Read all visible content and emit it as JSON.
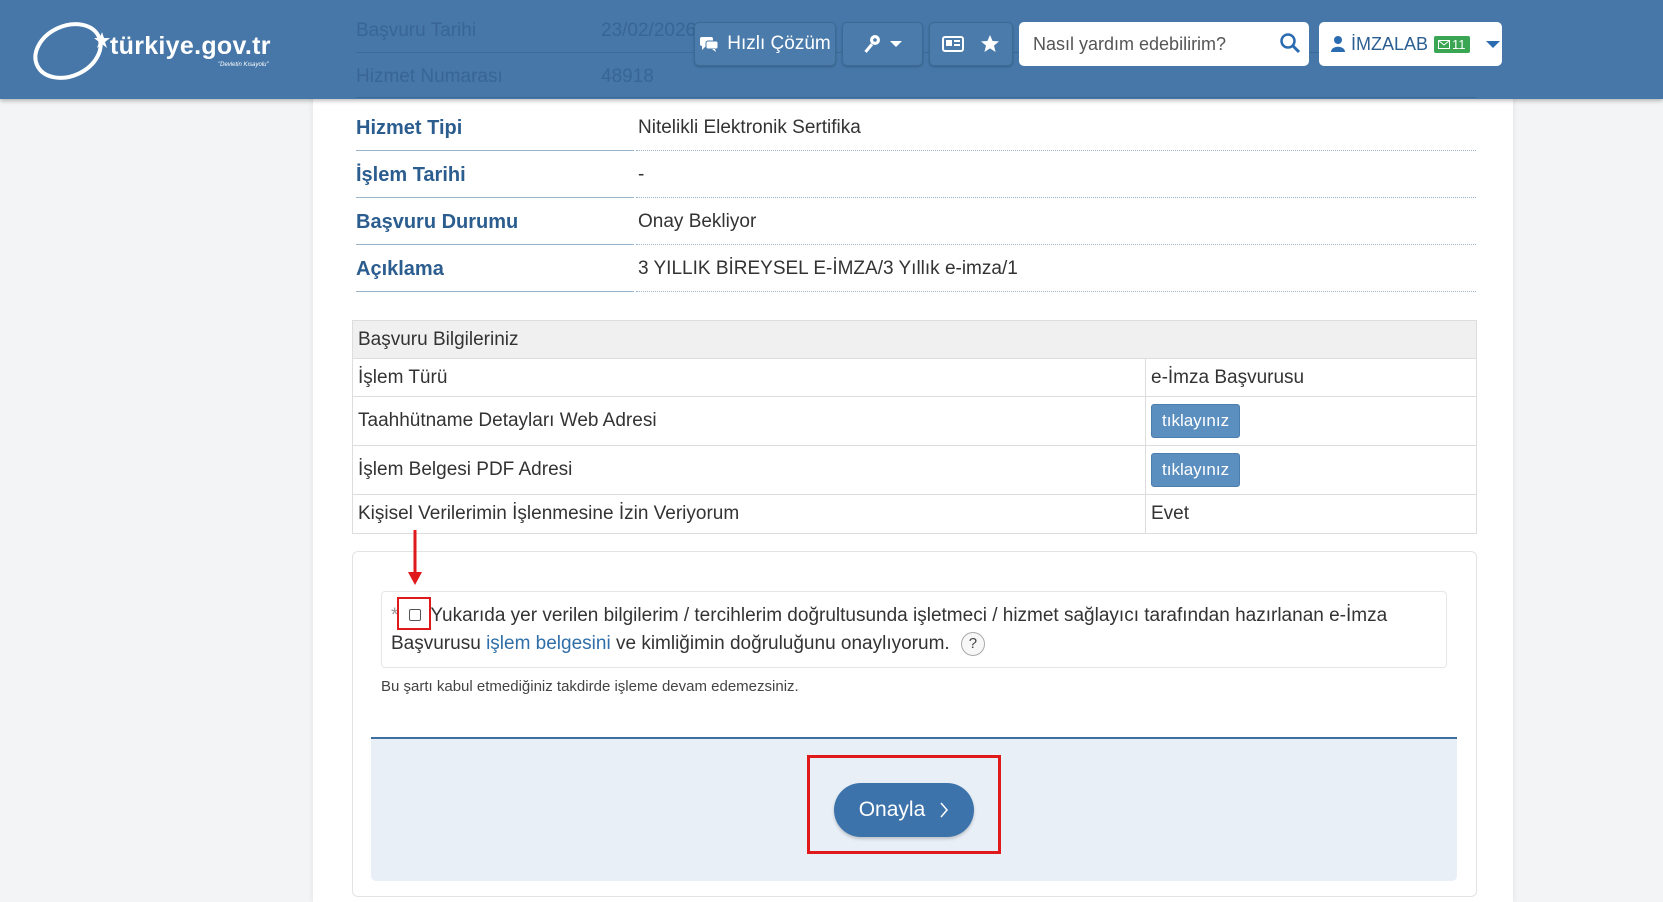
{
  "header": {
    "logo_text": "türkiye.gov.tr",
    "logo_sub": "\"Devletin Kısayolu\"",
    "quick_solution_label": "Hızlı Çözüm",
    "search_placeholder": "Nasıl yardım edebilirim?",
    "user_name": "İMZALAB",
    "mail_count": "11",
    "faded_rows": [
      {
        "label": "Başvuru Tarihi",
        "value": "23/02/2026"
      },
      {
        "label": "Hizmet Numarası",
        "value": "48918"
      }
    ]
  },
  "info_rows": [
    {
      "label": "Hizmet Tipi",
      "value": "Nitelikli Elektronik Sertifika"
    },
    {
      "label": "İşlem Tarihi",
      "value": "-"
    },
    {
      "label": "Başvuru Durumu",
      "value": "Onay Bekliyor"
    },
    {
      "label": "Açıklama",
      "value": "3 YILLIK BİREYSEL E-İMZA/3 Yıllık e-imza/1"
    }
  ],
  "application_table": {
    "title": "Başvuru Bilgileriniz",
    "rows": [
      {
        "label": "İşlem Türü",
        "value": "e-İmza Başvurusu"
      },
      {
        "label": "Taahhütname Detayları Web Adresi",
        "button": "tıklayınız"
      },
      {
        "label": "İşlem Belgesi PDF Adresi",
        "button": "tıklayınız"
      },
      {
        "label": "Kişisel Verilerimin İşlenmesine İzin Veriyorum",
        "value": "Evet"
      }
    ]
  },
  "consent": {
    "asterisk": "*",
    "text_before": "Yukarıda yer verilen bilgilerim / tercihlerim doğrultusunda işletmeci / hizmet sağlayıcı tarafından hazırlanan e-İmza Başvurusu",
    "link_text": "işlem belgesini",
    "text_after": "ve kimliğimin doğruluğunu onaylıyorum.",
    "help": "?",
    "note": "Bu şartı kabul etmediğiniz takdirde işleme devam edemezsiniz.",
    "checked": false
  },
  "actions": {
    "confirm_label": "Onayla"
  },
  "colors": {
    "header_bg": "#4677a8",
    "label_blue": "#2c5d8f",
    "highlight_red": "#e01a1a",
    "confirm_button": "#3c73aa"
  }
}
